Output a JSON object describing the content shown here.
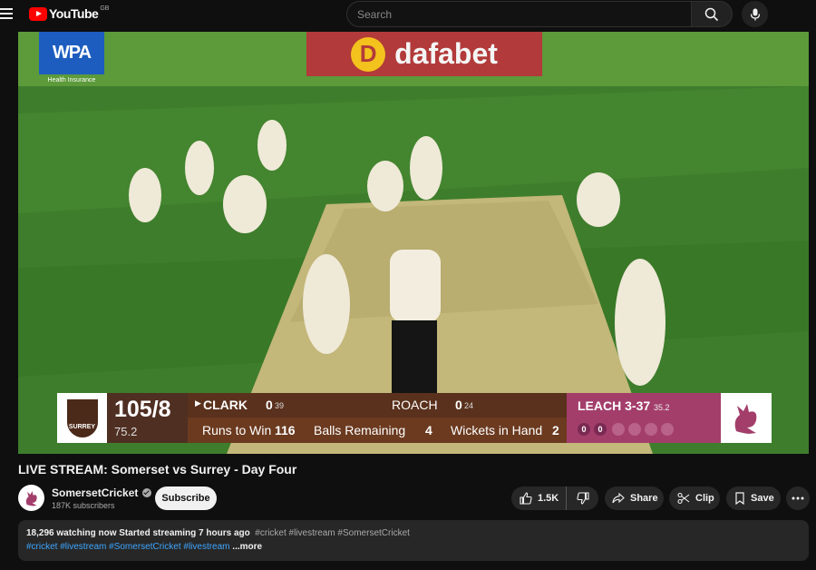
{
  "header": {
    "logo_text": "YouTube",
    "country_code": "GB",
    "search_placeholder": "Search"
  },
  "video": {
    "ads": {
      "wpa_logo": "WPA",
      "wpa_tagline": "Health Insurance",
      "dafabet_logo": "dafabet"
    },
    "scoreboard": {
      "team_crest": "SURREY",
      "score": "105/8",
      "overs": "75.2",
      "batter1_name": "CLARK",
      "batter1_runs": "0",
      "batter1_balls": "39",
      "batter2_name": "ROACH",
      "batter2_runs": "0",
      "batter2_balls": "24",
      "runs_to_win_label": "Runs to Win",
      "runs_to_win": "116",
      "balls_remaining_label": "Balls Remaining",
      "balls_remaining": "4",
      "wickets_label": "Wickets in Hand",
      "wickets": "2",
      "bowler_name": "LEACH",
      "bowler_figures": "3-37",
      "bowler_overs": "35.2",
      "balls": [
        "0",
        "0",
        "",
        "",
        "",
        ""
      ]
    }
  },
  "title": "LIVE STREAM: Somerset vs Surrey - Day Four",
  "channel": {
    "name": "SomersetCricket",
    "subscribers": "187K subscribers",
    "subscribe_label": "Subscribe"
  },
  "actions": {
    "likes": "1.5K",
    "share_label": "Share",
    "clip_label": "Clip",
    "save_label": "Save"
  },
  "description": {
    "stats": "18,296 watching now  Started streaming 7 hours ago",
    "tags_line1": "#cricket #livestream #SomersetCricket",
    "tags_line2": "#cricket #livestream #SomersetCricket #livestream",
    "more_label": "...more"
  },
  "colors": {
    "accent_red": "#ff0000",
    "surrey_brown": "#4f2f22",
    "somerset_maroon": "#a33e6b",
    "pitch_green": "#3b7a2b"
  }
}
